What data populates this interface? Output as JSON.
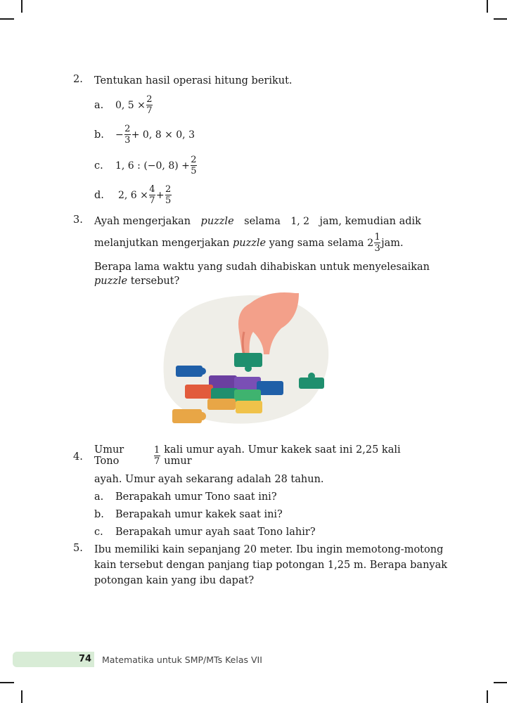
{
  "q2": {
    "number": "2.",
    "prompt": "Tentukan hasil operasi hitung berikut.",
    "items": [
      {
        "letter": "a.",
        "pre": "0, 5 ×",
        "num": "2",
        "den": "7",
        "post": ""
      },
      {
        "letter": "b.",
        "pre": "−",
        "num": "2",
        "den": "3",
        "post": "+ 0, 8 × 0, 3"
      },
      {
        "letter": "c.",
        "pre": "1, 6 : (−0, 8) +",
        "num": "2",
        "den": "5",
        "post": ""
      },
      {
        "letter": "d.",
        "pre": "2, 6 ×",
        "num": "4",
        "den": "7",
        "mid": "+",
        "num2": "2",
        "den2": "5"
      }
    ]
  },
  "q3": {
    "number": "3.",
    "line1_a": "Ayah mengerjakan",
    "line1_em": "puzzle",
    "line1_b": "selama",
    "line1_val": "1, 2",
    "line1_c": "jam, kemudian adik",
    "line2_a": "melanjutkan mengerjakan",
    "line2_em": "puzzle",
    "line2_b": "yang sama selama",
    "mixed_whole": "2",
    "mixed_num": "1",
    "mixed_den": "3",
    "line2_c": "jam.",
    "line3": "Berapa lama waktu yang sudah dihabiskan untuk menyelesaikan",
    "line4_em": "puzzle",
    "line4_b": "tersebut?"
  },
  "q4": {
    "number": "4.",
    "line1_a": "Umur Tono",
    "frac_num": "1",
    "frac_den": "7",
    "line1_b": "kali umur ayah. Umur kakek saat ini 2,25 kali umur",
    "line2": "ayah. Umur ayah sekarang adalah 28 tahun.",
    "items": [
      {
        "letter": "a.",
        "text": "Berapakah umur Tono saat ini?"
      },
      {
        "letter": "b.",
        "text": "Berapakah umur kakek saat ini?"
      },
      {
        "letter": "c.",
        "text": "Berapakah umur ayah saat Tono lahir?"
      }
    ]
  },
  "q5": {
    "number": "5.",
    "lines": [
      "Ibu memiliki kain sepanjang 20 meter. Ibu ingin memotong-motong",
      "kain tersebut dengan panjang tiap potongan 1,25 m. Berapa banyak",
      "potongan kain yang ibu dapat?"
    ]
  },
  "footer": {
    "page_number": "74",
    "title": "Matematika untuk SMP/MTs Kelas VII"
  },
  "colors": {
    "footer_band": "#d8ecd6",
    "puzzle_blue": "#1f5fa8",
    "puzzle_green": "#1f8f6e",
    "puzzle_purple": "#6b3fa0",
    "puzzle_orange": "#e8a646",
    "puzzle_red": "#e25b3c",
    "hand": "#f3a08a",
    "backdrop": "#efeee8"
  }
}
